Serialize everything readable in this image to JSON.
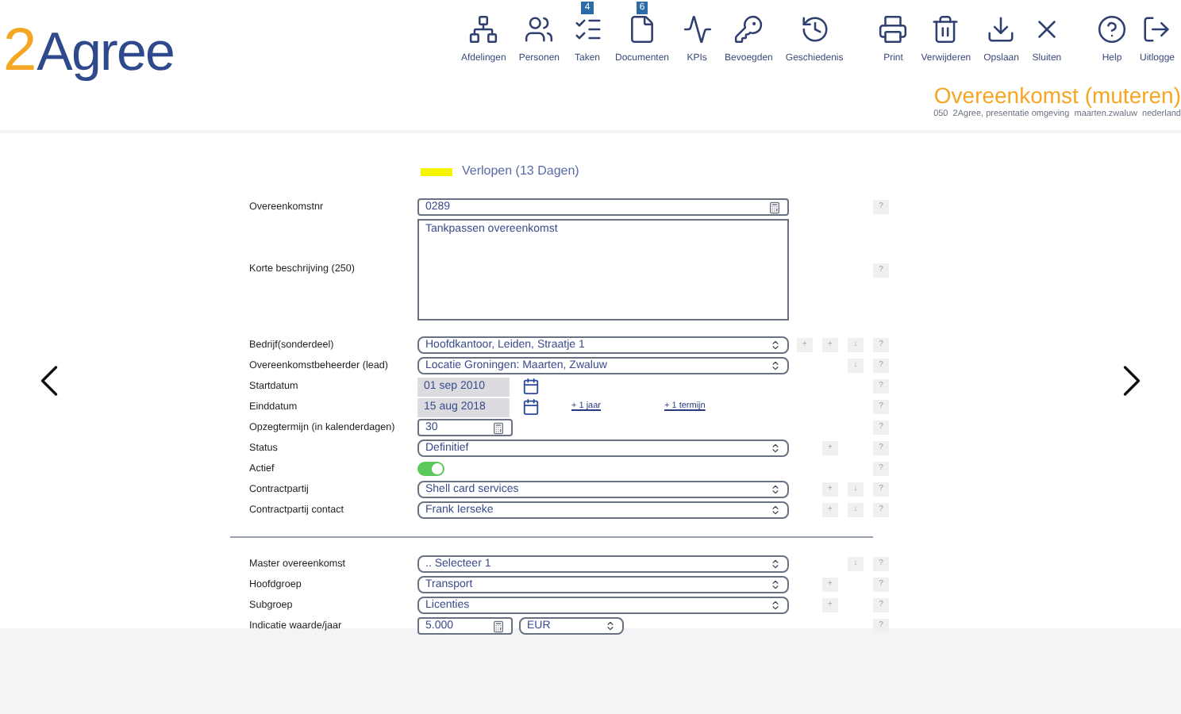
{
  "logo": {
    "digit": "2",
    "word": "Agree"
  },
  "toolbar": [
    {
      "label": "Afdelingen"
    },
    {
      "label": "Personen"
    },
    {
      "label": "Taken",
      "badge": "4"
    },
    {
      "label": "Documenten",
      "badge": "6"
    },
    {
      "label": "KPIs"
    },
    {
      "label": "Bevoegden"
    },
    {
      "label": "Geschiedenis"
    },
    {
      "label": "Print"
    },
    {
      "label": "Verwijderen"
    },
    {
      "label": "Opslaan"
    },
    {
      "label": "Sluiten"
    },
    {
      "label": "Help"
    },
    {
      "label": "Uitlogge"
    }
  ],
  "page_title": "Overeenkomst (muteren)",
  "breadcrumb": "050  2Agree, presentatie omgeving  maarten.zwaluw  nederland",
  "status": {
    "label": "Verlopen (13 Dagen)",
    "color": "#f5f500"
  },
  "section_1": [
    {
      "label": "Overeenkomstnr",
      "kind": "number",
      "value": "0289",
      "actions": [
        {
          "label": "?",
          "kind": "help"
        }
      ]
    },
    {
      "label": "Korte beschrijving (250)",
      "kind": "textarea",
      "value": "Tankpassen overeenkomst",
      "actions": [
        {
          "label": "?",
          "kind": "help"
        }
      ]
    },
    {
      "label": "Bedrijf(sonderdeel)",
      "kind": "select",
      "value": "Hoofdkantoor, Leiden, Straatje 1",
      "actions": [
        {
          "label": "+",
          "kind": "new"
        },
        {
          "label": "+",
          "kind": "add"
        },
        {
          "label": "↓",
          "kind": "down"
        },
        {
          "label": "?",
          "kind": "help"
        }
      ]
    },
    {
      "label": "Overeenkomstbeheerder (lead)",
      "kind": "select",
      "value": "Locatie Groningen: Maarten, Zwaluw",
      "actions": [
        {
          "label": "↓",
          "kind": "down"
        },
        {
          "label": "?",
          "kind": "help"
        }
      ]
    },
    {
      "label": "Startdatum",
      "kind": "date",
      "value": "01 sep 2010",
      "actions": [
        {
          "label": "?",
          "kind": "help"
        }
      ]
    },
    {
      "label": "Einddatum",
      "kind": "date",
      "value": "15 aug 2018",
      "links": [
        "+ 1 jaar",
        "+ 1 termijn"
      ],
      "actions": [
        {
          "label": "?",
          "kind": "help"
        }
      ]
    },
    {
      "label": "Opzegtermijn (in kalenderdagen)",
      "kind": "number_short",
      "value": "30",
      "actions": [
        {
          "label": "?",
          "kind": "help"
        }
      ]
    },
    {
      "label": "Status",
      "kind": "select",
      "value": "Definitief",
      "actions": [
        {
          "label": "+",
          "kind": "add"
        },
        {
          "label": "?",
          "kind": "help"
        }
      ]
    },
    {
      "label": "Actief",
      "kind": "toggle",
      "on": true,
      "actions": [
        {
          "label": "?",
          "kind": "help"
        }
      ]
    },
    {
      "label": "Contractpartij",
      "kind": "select",
      "value": "Shell card services",
      "actions": [
        {
          "label": "+",
          "kind": "add"
        },
        {
          "label": "↓",
          "kind": "down"
        },
        {
          "label": "?",
          "kind": "help"
        }
      ]
    },
    {
      "label": "Contractpartij contact",
      "kind": "select",
      "value": "Frank Ierseke",
      "actions": [
        {
          "label": "+",
          "kind": "add"
        },
        {
          "label": "↓",
          "kind": "down"
        },
        {
          "label": "?",
          "kind": "help"
        }
      ]
    }
  ],
  "section_2": [
    {
      "label": "Master overeenkomst",
      "kind": "select",
      "value": ".. Selecteer 1",
      "actions": [
        {
          "label": "↓",
          "kind": "down"
        },
        {
          "label": "?",
          "kind": "help"
        }
      ]
    },
    {
      "label": "Hoofdgroep",
      "kind": "select",
      "value": "Transport",
      "actions": [
        {
          "label": "+",
          "kind": "add"
        },
        {
          "label": "?",
          "kind": "help"
        }
      ]
    },
    {
      "label": "Subgroep",
      "kind": "select",
      "value": "Licenties",
      "actions": [
        {
          "label": "+",
          "kind": "add"
        },
        {
          "label": "?",
          "kind": "help"
        }
      ]
    },
    {
      "label": "Indicatie waarde/jaar",
      "kind": "amount",
      "value": "5.000",
      "currency": "EUR",
      "actions": [
        {
          "label": "?",
          "kind": "help"
        }
      ]
    }
  ]
}
